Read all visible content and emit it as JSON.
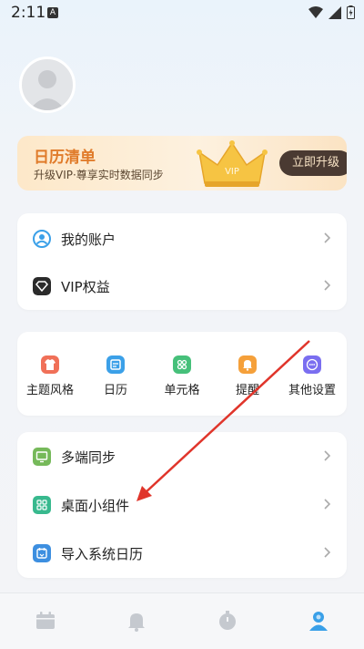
{
  "status": {
    "time": "2:11",
    "badge": "A"
  },
  "vip_banner": {
    "title": "日历清单",
    "subtitle": "升级VIP·尊享实时数据同步",
    "crown_text": "VIP",
    "button": "立即升级"
  },
  "account_card": {
    "items": [
      {
        "label": "我的账户",
        "icon": "user-icon"
      },
      {
        "label": "VIP权益",
        "icon": "vip-diamond-icon"
      }
    ]
  },
  "settings_grid": {
    "items": [
      {
        "label": "主题风格",
        "icon": "shirt-icon",
        "color": "#f07058"
      },
      {
        "label": "日历",
        "icon": "calendar-icon",
        "color": "#3ba0e8"
      },
      {
        "label": "单元格",
        "icon": "grid-icon",
        "color": "#46c07a"
      },
      {
        "label": "提醒",
        "icon": "bell-icon",
        "color": "#f5a03a"
      },
      {
        "label": "其他设置",
        "icon": "more-icon",
        "color": "#7a6ef0"
      }
    ]
  },
  "tools_card": {
    "items": [
      {
        "label": "多端同步",
        "icon": "sync-icon",
        "color": "#76b95a"
      },
      {
        "label": "桌面小组件",
        "icon": "widget-icon",
        "color": "#38b98e"
      },
      {
        "label": "导入系统日历",
        "icon": "import-calendar-icon",
        "color": "#3d8fe0"
      }
    ]
  },
  "tabbar": {
    "items": [
      {
        "name": "calendar-tab",
        "icon": "calendar-icon"
      },
      {
        "name": "reminder-tab",
        "icon": "bell-icon"
      },
      {
        "name": "timer-tab",
        "icon": "stopwatch-icon"
      },
      {
        "name": "profile-tab",
        "icon": "person-icon",
        "active": true
      }
    ]
  },
  "colors": {
    "accent": "#3aa0e8",
    "vip_orange": "#e07b2a",
    "arrow_red": "#e0352b"
  }
}
